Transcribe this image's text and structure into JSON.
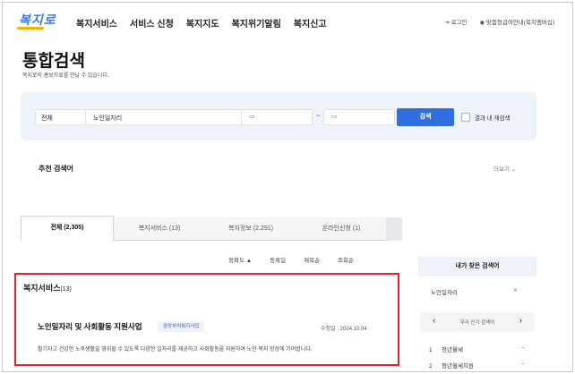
{
  "header": {
    "logo": "복지로",
    "nav": [
      "복지서비스",
      "서비스 신청",
      "복지지도",
      "복지위기알림",
      "복지신고"
    ],
    "login": "로그인",
    "lang": "맞춤형급여안내(복지멤버십)"
  },
  "page": {
    "title": "통합검색",
    "desc": "복지로의 홍보자료를 만날 수 있습니다."
  },
  "search": {
    "scope": "전체",
    "keyword": "노인일자리",
    "date_from": "",
    "date_to": "",
    "date_sep": "~",
    "button": "검색",
    "within_results": "결과 내 재검색"
  },
  "recommend": {
    "title": "추천 검색어",
    "more": "더보기"
  },
  "tabs": [
    {
      "label": "전체 (2,305)",
      "active": true
    },
    {
      "label": "복지서비스 (13)",
      "active": false
    },
    {
      "label": "복지정보 (2,291)",
      "active": false
    },
    {
      "label": "온라인신청 (1)",
      "active": false
    }
  ],
  "sorts": [
    "정확도 ▲",
    "등록일",
    "제목순",
    "조회순"
  ],
  "results": {
    "section_title": "복지서비스",
    "section_count": "(13)",
    "item": {
      "title": "노인일자리 및 사회활동 지원사업",
      "badge": "중앙부처복지사업",
      "modified": "수정일 : 2024.10.04",
      "desc": "활기차고 건강한 노후생활을 영위할 수 있도록 다양한 일자리를 제공하고 사회활동을 지원하여 노인 복지 향상에 기여합니다."
    }
  },
  "side": {
    "head": "내가 찾은 검색어",
    "my_keyword": "노인일자리",
    "popular_label": "우리 인기 검색어",
    "ranks": [
      {
        "num": "1",
        "text": "청년월세"
      },
      {
        "num": "2",
        "text": "청년월세지원"
      }
    ]
  },
  "colors": {
    "primary": "#2f6fe0",
    "highlight": "#e2262b",
    "panel": "#eef2f9"
  }
}
